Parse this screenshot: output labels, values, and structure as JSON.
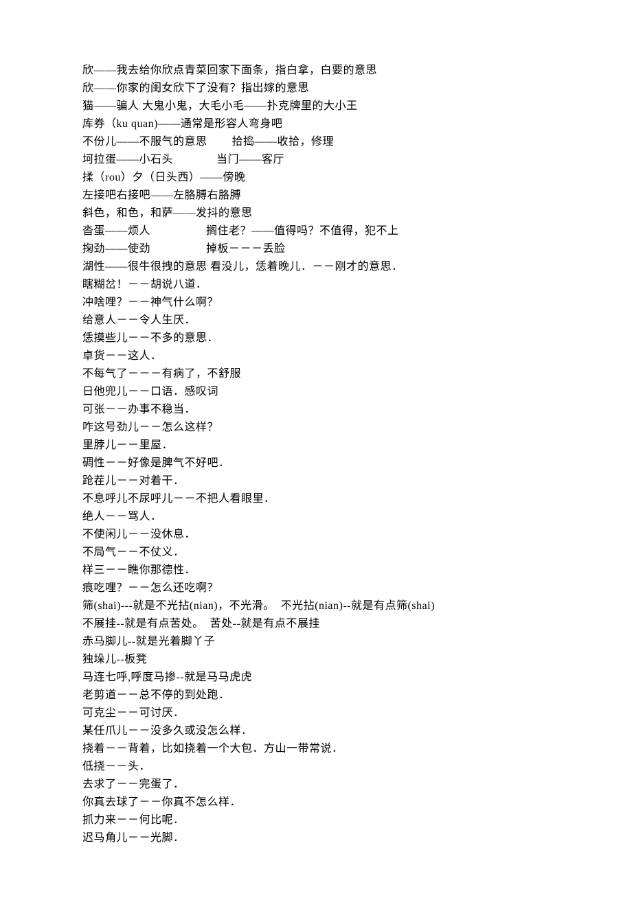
{
  "lines": [
    "欣——我去给你欣点青菜回家下面条，指白拿，白要的意思",
    "欣——你家的闺女欣下了没有？指出嫁的意思",
    "猫——骗人 大鬼小鬼，大毛小毛——扑克牌里的大小王",
    "库券（ku quan)——通常是形容人弯身吧",
    "不份儿——不服气的意思        拾捣——收拾，修理",
    "坷拉蛋——小石头              当门——客厅",
    "揉（rou）夕（日头西）——傍晚",
    "左接吧右接吧——左胳膊右胳膊",
    "斜色，和色，和萨——发抖的意思",
    "沓蛋——烦人                  搁住老？——值得吗？不值得，犯不上",
    "掬劲——使劲                  掉板－－－丢脸",
    "湖性——很牛很拽的意思 看没儿，恁着晚儿．－－刚才的意思．",
    "瞎糊岔！－－胡说八道．",
    "冲啥哩？－－神气什么啊？",
    "给意人－－令人生厌．",
    "恁摸些儿－－不多的意思．",
    "卓货－－这人．",
    "不每气了－－－有病了，不舒服",
    "日他兜儿－－口语．感叹词",
    "可张－－办事不稳当．",
    "咋这号劲儿－－怎么这样？",
    "里脖儿－－里屋．",
    "碉性－－好像是脾气不好吧．",
    "跄茬儿－－对着干．",
    "不息呼儿不尿呼儿－－不把人看眼里．",
    "绝人－－骂人．",
    "不使闲儿－－没休息．",
    "不局气－－不仗义．",
    "样三－－瞧你那德性．",
    "痕吃哩？－－怎么还吃啊？",
    "筛(shai)---就是不光拈(nian)，不光滑。  不光拈(nian)--就是有点筛(shai)",
    "不展挂--就是有点苦处。  苦处--就是有点不展挂",
    "赤马脚儿--就是光着脚丫子",
    "独垛儿--板凳",
    "马连七呼,呼度马掺--就是马马虎虎",
    "老剪道－－总不停的到处跑．",
    "可克尘－－可讨厌．",
    "某任爪儿－－没多久或没怎么样．",
    "挠着－－背着，比如挠着一个大包．方山一带常说．",
    "低挠－－头．",
    "去求了－－完蛋了．",
    "你真去球了－－你真不怎么样．",
    "抓力来－－何比呢．",
    "迟马角儿－－光脚．"
  ]
}
